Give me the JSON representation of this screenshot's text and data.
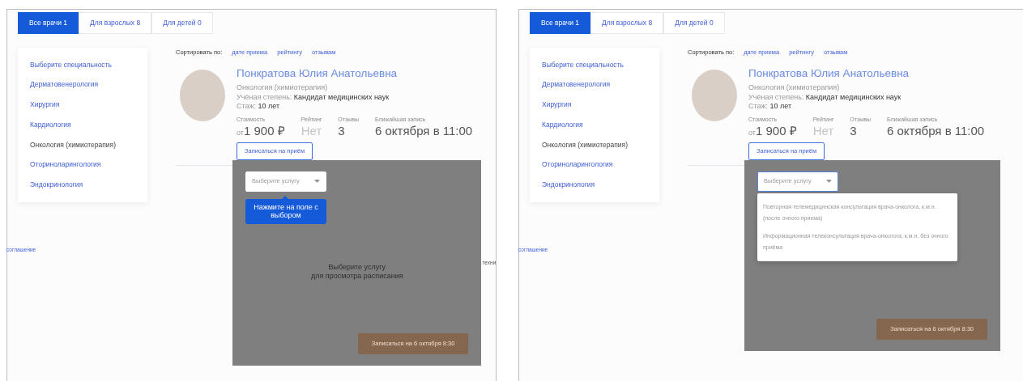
{
  "panels": [
    {
      "tabs": [
        {
          "label": "Все врачи 1",
          "selected": true
        },
        {
          "label": "Для взрослых 8",
          "selected": false
        },
        {
          "label": "Для детей 0",
          "selected": false
        }
      ],
      "specialties": [
        {
          "label": "Выберите специальность",
          "selected": false
        },
        {
          "label": "Дерматовенерология",
          "selected": false
        },
        {
          "label": "Хирургия",
          "selected": false
        },
        {
          "label": "Кардиология",
          "selected": false
        },
        {
          "label": "Онкология (химиотерапия)",
          "selected": true
        },
        {
          "label": "Оториноларингология",
          "selected": false
        },
        {
          "label": "Эндокринология",
          "selected": false
        }
      ],
      "footer_link": "соглашение",
      "sort": {
        "label": "Сортировать по:",
        "options": [
          "дате приема",
          "рейтингу",
          "отзывам"
        ]
      },
      "doctor": {
        "name": "Понкратова Юлия Анатольевна",
        "specialty": "Онкология (химиотерапия)",
        "degree_label": "Учёная степень:",
        "degree": "Кандидат медицинских наук",
        "experience_label": "Стаж:",
        "experience": "10 лет",
        "stats": [
          {
            "label": "Стоимость",
            "prefix": "от",
            "value": "1 900 ₽",
            "muted": false
          },
          {
            "label": "Рейтинг",
            "value": "Нет",
            "muted": true
          },
          {
            "label": "Отзывы",
            "value": "3",
            "muted": false
          },
          {
            "label": "Ближайшая запись",
            "value": "6 октября в 11:00",
            "muted": false
          }
        ],
        "book_button": "Записаться на приём"
      },
      "booking": {
        "service_select": {
          "placeholder": "Выберите услугу",
          "focused": false
        },
        "tooltip": "Нажмите на поле с выбором",
        "hint": "Выберите услугу",
        "hint_sub": "для просмотра расписания",
        "book_button": "Записаться на 6 октября 8:30"
      },
      "edge_text": "техни"
    },
    {
      "tabs": [
        {
          "label": "Все врачи 1",
          "selected": true
        },
        {
          "label": "Для взрослых 8",
          "selected": false
        },
        {
          "label": "Для детей 0",
          "selected": false
        }
      ],
      "specialties": [
        {
          "label": "Выберите специальность",
          "selected": false
        },
        {
          "label": "Дерматовенерология",
          "selected": false
        },
        {
          "label": "Хирургия",
          "selected": false
        },
        {
          "label": "Кардиология",
          "selected": false
        },
        {
          "label": "Онкология (химиотерапия)",
          "selected": true
        },
        {
          "label": "Оториноларингология",
          "selected": false
        },
        {
          "label": "Эндокринология",
          "selected": false
        }
      ],
      "footer_link": "соглашение",
      "sort": {
        "label": "Сортировать по:",
        "options": [
          "дате приема",
          "рейтингу",
          "отзывам"
        ]
      },
      "doctor": {
        "name": "Понкратова Юлия Анатольевна",
        "specialty": "Онкология (химиотерапия)",
        "degree_label": "Учёная степень:",
        "degree": "Кандидат медицинских наук",
        "experience_label": "Стаж:",
        "experience": "10 лет",
        "stats": [
          {
            "label": "Стоимость",
            "prefix": "от",
            "value": "1 900 ₽",
            "muted": false
          },
          {
            "label": "Рейтинг",
            "value": "Нет",
            "muted": true
          },
          {
            "label": "Отзывы",
            "value": "3",
            "muted": false
          },
          {
            "label": "Ближайшая запись",
            "value": "6 октября в 11:00",
            "muted": false
          }
        ],
        "book_button": "Записаться на приём"
      },
      "booking": {
        "service_select": {
          "placeholder": "Выберите услугу",
          "focused": true
        },
        "options": [
          "Повторная телемедицинская консультация врача-онколога, к.м.н. (после очного приема)",
          "Информационная телеконсультация врача-онколога, к.м.н. без очного приёма"
        ],
        "book_button": "Записаться на 6 октября 8:30"
      }
    }
  ]
}
